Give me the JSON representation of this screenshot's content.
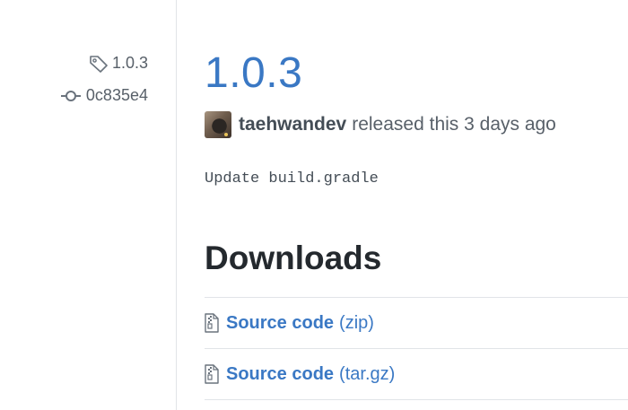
{
  "sidebar": {
    "tag": "1.0.3",
    "commit": "0c835e4"
  },
  "release": {
    "title": "1.0.3",
    "author": "taehwandev",
    "released_text": "released this 3 days ago",
    "body": "Update build.gradle"
  },
  "downloads": {
    "heading": "Downloads",
    "items": [
      {
        "label": "Source code",
        "format": "(zip)",
        "icon": "file-zip-icon"
      },
      {
        "label": "Source code",
        "format": "(tar.gz)",
        "icon": "file-zip-icon"
      }
    ]
  },
  "colors": {
    "link": "#3a78c4",
    "muted": "#586069",
    "border": "#e1e4e8"
  }
}
